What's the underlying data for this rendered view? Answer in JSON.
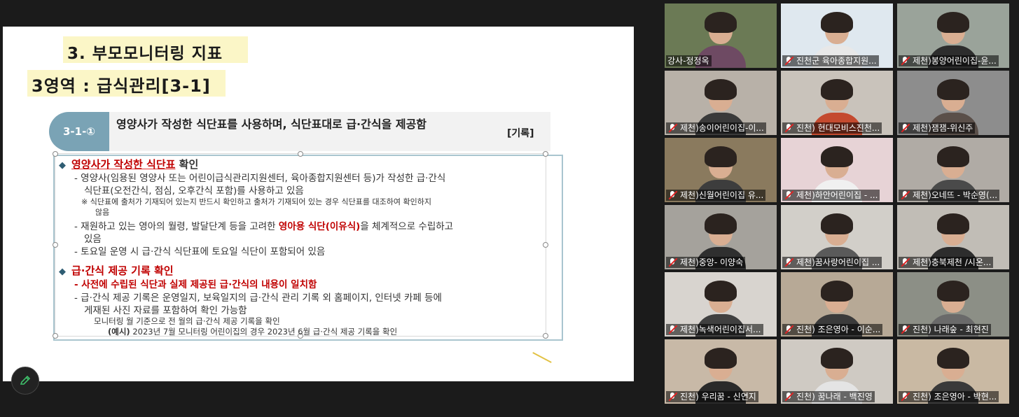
{
  "slide": {
    "title1": "3. 부모모니터링 지표",
    "title2": "3영역 : 급식관리[3-1]",
    "header": {
      "code": "3-1-①",
      "text": "영양사가 작성한 식단표를 사용하며, 식단표대로 급·간식을 제공함",
      "tag": "[기록]"
    },
    "sec1_red": "영양사가 작성한 식단표",
    "sec1_rest": " 확인",
    "l1": "- 영양사(임용된 영양사 또는 어린이급식관리지원센터, 육아종합지원센터 등)가 작성한 급·간식",
    "l2": "식단표(오전간식, 점심, 오후간식 포함)를 사용하고 있음",
    "l3": "※ 식단표에 출처가 기재되어 있는지 반드시 확인하고 출처가 기재되어 있는 경우 식단표를 대조하여 확인하지",
    "l4": "않음",
    "l5a": "- 재원하고 있는 영아의 월령, 발달단계 등을 고려한 ",
    "l5b": "영아용 식단(이유식)",
    "l5c": "을 체계적으로 수립하고",
    "l6": "있음",
    "l7": "- 토요일 운영 시 급·간식 식단표에 토요일 식단이 포함되어 있음",
    "sec2": "급·간식 제공 기록 확인",
    "l8": "- 사전에 수립된 식단과 실제 제공된 급·간식의 내용이 일치함",
    "l9": "- 급·간식 제공 기록은 운영일지, 보육일지의 급·간식 관리 기록 외 홈페이지, 인터넷 카페 등에",
    "l10": "게재된 사진 자료를 포함하여 확인 가능함",
    "l11": "모니터링 월 기준으로 전 월의 급·간식 제공 기록을 확인",
    "l12a": "(예시)",
    "l12b": " 2023년 7월 모니터링 어린이집의 경우 2023년 6월 급·간식 제공 기록을 확인"
  },
  "participants": [
    {
      "name": "강사-정정옥",
      "muted": false,
      "active": true,
      "bg": "#6b7a55"
    },
    {
      "name": "진천군 육아종합지원...",
      "muted": true,
      "active": false,
      "bg": "#dfe8ef"
    },
    {
      "name": "제천)봉양어린이집-윤...",
      "muted": true,
      "active": false,
      "bg": "#9aa39a"
    },
    {
      "name": "제천)송이어린이집-이...",
      "muted": true,
      "active": false,
      "bg": "#b8b1a8"
    },
    {
      "name": "진천) 현대모비스진천...",
      "muted": true,
      "active": false,
      "bg": "#c9c3bb"
    },
    {
      "name": "제천)잼잼-위신주",
      "muted": true,
      "active": false,
      "bg": "#8d8d8d"
    },
    {
      "name": "제천)신월어린이집 유...",
      "muted": true,
      "active": false,
      "bg": "#8a7a5e"
    },
    {
      "name": "제천)하안어린이집 - ...",
      "muted": true,
      "active": false,
      "bg": "#e7d3d6"
    },
    {
      "name": "제천)오네뜨 - 박순영(...",
      "muted": true,
      "active": false,
      "bg": "#b0aba5"
    },
    {
      "name": "제천)중앙- 이양숙",
      "muted": true,
      "active": false,
      "bg": "#a5a29c"
    },
    {
      "name": "제천)꿈사랑어린이집 ...",
      "muted": true,
      "active": false,
      "bg": "#d2cfc9"
    },
    {
      "name": "제천)충북제천 /시온...",
      "muted": true,
      "active": false,
      "bg": "#c1bdb6"
    },
    {
      "name": "제천)녹색어린이집서...",
      "muted": true,
      "active": false,
      "bg": "#d8d4cf"
    },
    {
      "name": "진천) 조은영아 - 이순...",
      "muted": true,
      "active": false,
      "bg": "#b7a996"
    },
    {
      "name": "진천) 나래숲 - 최현진",
      "muted": true,
      "active": false,
      "bg": "#8c8f86"
    },
    {
      "name": "진천) 우리꿈 - 신연지",
      "muted": true,
      "active": false,
      "bg": "#c8b9a7"
    },
    {
      "name": "진천) 꿈나래 - 백진영",
      "muted": true,
      "active": false,
      "bg": "#cfcac3"
    },
    {
      "name": "진천) 조은영아 - 박현...",
      "muted": true,
      "active": false,
      "bg": "#c9b9a3"
    }
  ],
  "icons": {
    "edit": "pencil-icon",
    "mic": "mic-off-icon"
  }
}
